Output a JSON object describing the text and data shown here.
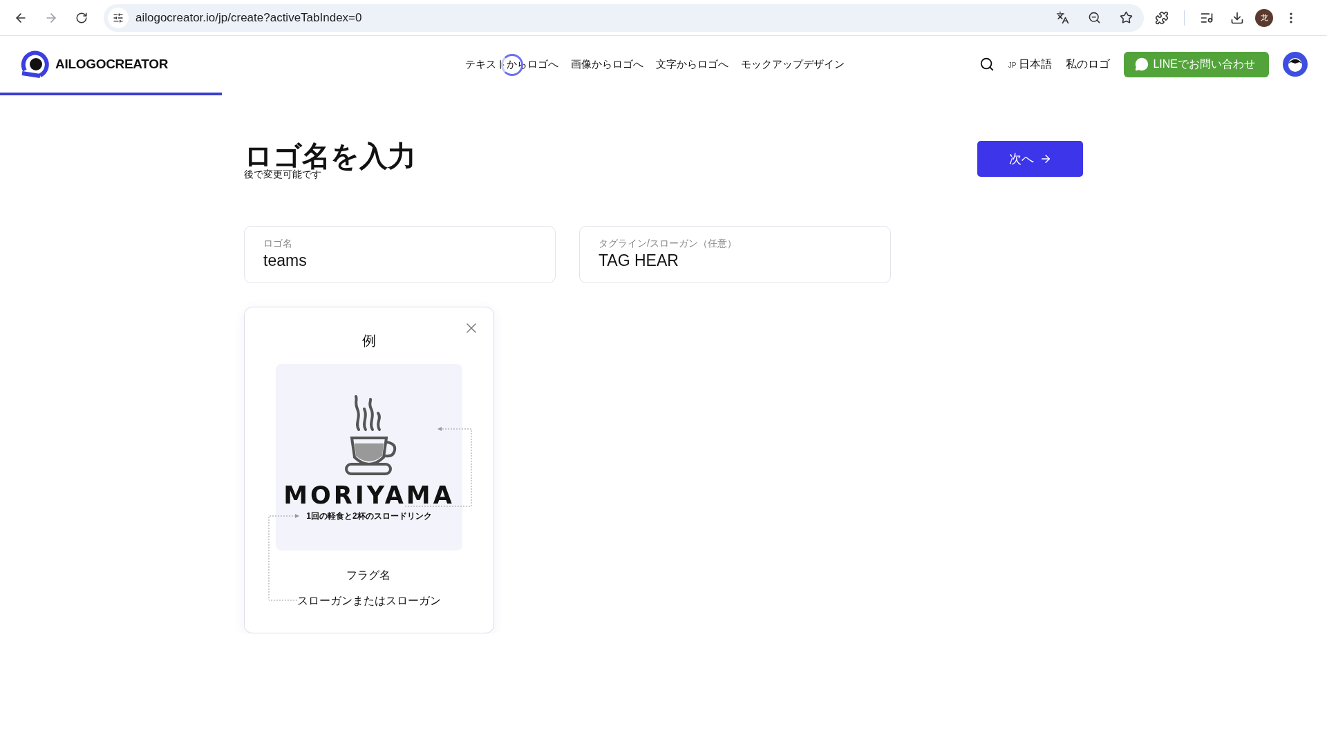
{
  "browser": {
    "url": "ailogocreator.io/jp/create?activeTabIndex=0",
    "profile_label": "龙"
  },
  "header": {
    "brand": "AILOGOCREATOR",
    "nav": [
      "テキストからロゴへ",
      "画像からロゴへ",
      "文字からロゴへ",
      "モックアップデザイン"
    ],
    "loading": true,
    "language": {
      "code": "JP",
      "label": "日本語"
    },
    "my_logos": "私のロゴ",
    "contact_button": "LINEでお問い合わせ",
    "progress": {
      "level": 0.167
    }
  },
  "page": {
    "title": "ロゴ名を入力",
    "subtitle": "後で変更可能です",
    "next_button": "次へ"
  },
  "fields": [
    {
      "label": "ロゴ名",
      "value": "teams"
    },
    {
      "label": "タグライン/スローガン（任意）",
      "value": "TAG HEAR"
    }
  ],
  "example": {
    "title": "例",
    "logo_name": "MORIYAMA",
    "logo_slogan": "1回の軽食と2杯のスロードリンク",
    "name_caption": "フラグ名",
    "slogan_caption": "スローガンまたはスローガン"
  }
}
